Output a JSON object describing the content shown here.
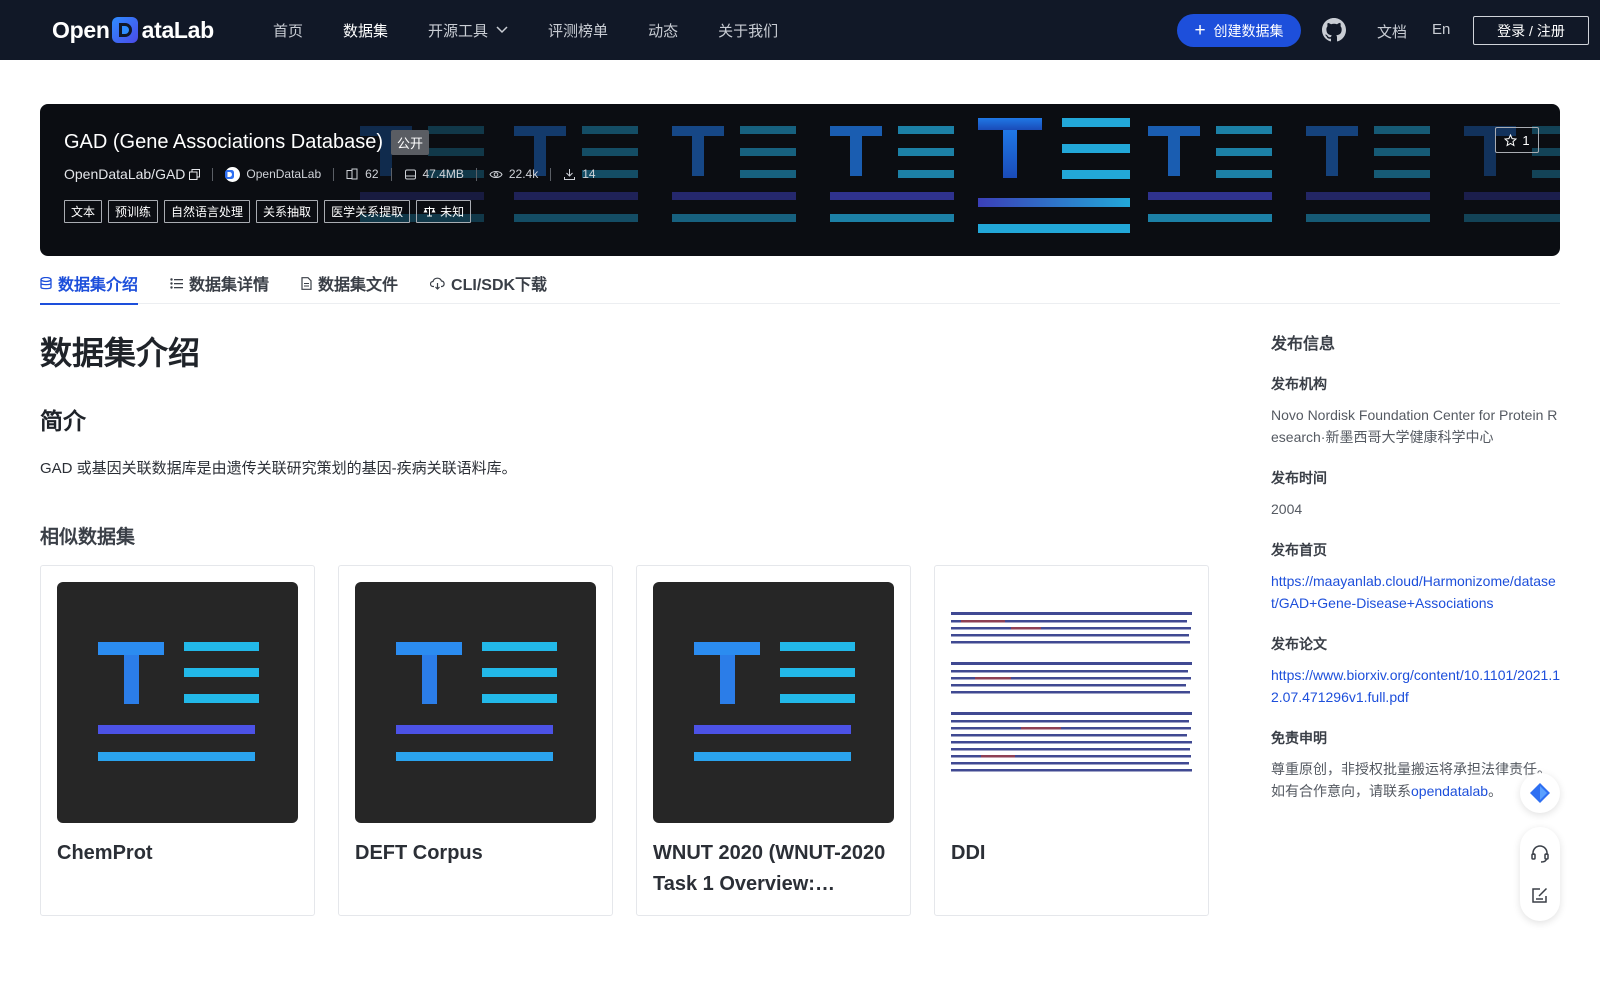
{
  "brand": {
    "name_left": "Open",
    "name_right": "ataLab"
  },
  "nav": {
    "items": [
      {
        "label": "首页",
        "active": false
      },
      {
        "label": "数据集",
        "active": true
      },
      {
        "label": "开源工具",
        "active": false,
        "dropdown": true
      },
      {
        "label": "评测榜单",
        "active": false
      },
      {
        "label": "动态",
        "active": false
      },
      {
        "label": "关于我们",
        "active": false
      }
    ],
    "create_label": "创建数据集",
    "docs_label": "文档",
    "lang_label": "En",
    "login_label": "登录 / 注册"
  },
  "dataset": {
    "title": "GAD (Gene Associations Database)",
    "visibility": "公开",
    "slug": "OpenDataLab/GAD",
    "org": "OpenDataLab",
    "stats": {
      "files": "62",
      "size": "47.4MB",
      "views": "22.4k",
      "downloads": "14"
    },
    "tags": [
      "文本",
      "预训练",
      "自然语言处理",
      "关系抽取",
      "医学关系提取"
    ],
    "license": "未知",
    "stars": "1"
  },
  "tabs": [
    {
      "label": "数据集介绍",
      "icon": "database-icon",
      "active": true
    },
    {
      "label": "数据集详情",
      "icon": "list-icon",
      "active": false
    },
    {
      "label": "数据集文件",
      "icon": "file-icon",
      "active": false
    },
    {
      "label": "CLI/SDK下载",
      "icon": "cloud-download-icon",
      "active": false
    }
  ],
  "main": {
    "heading": "数据集介绍",
    "brief_heading": "简介",
    "description": "GAD 或基因关联数据库是由遗传关联研究策划的基因-疾病关联语料库。",
    "similar_heading": "相似数据集",
    "similar": [
      {
        "title": "ChemProt",
        "thumb": "text-logo"
      },
      {
        "title": "DEFT Corpus",
        "thumb": "text-logo"
      },
      {
        "title": "WNUT 2020 (WNUT-2020 Task 1 Overview:…",
        "thumb": "text-logo"
      },
      {
        "title": "DDI",
        "thumb": "paper-scan"
      }
    ]
  },
  "sidebar": {
    "heading": "发布信息",
    "publisher_label": "发布机构",
    "publisher": "Novo Nordisk Foundation Center for Protein Research·新墨西哥大学健康科学中心",
    "date_label": "发布时间",
    "date": "2004",
    "homepage_label": "发布首页",
    "homepage": "https://maayanlab.cloud/Harmonizome/dataset/GAD+Gene-Disease+Associations",
    "paper_label": "发布论文",
    "paper": "https://www.biorxiv.org/content/10.1101/2021.12.07.471296v1.full.pdf",
    "disclaimer_label": "免责申明",
    "disclaimer_text": "尊重原创，非授权批量搬运将承担法律责任。如有合作意向，请联系",
    "disclaimer_link": "opendatalab",
    "disclaimer_end": "。"
  },
  "colors": {
    "accent": "#1d4fdb",
    "nav_bg": "#111827",
    "banner_bg": "#0b0d12"
  }
}
